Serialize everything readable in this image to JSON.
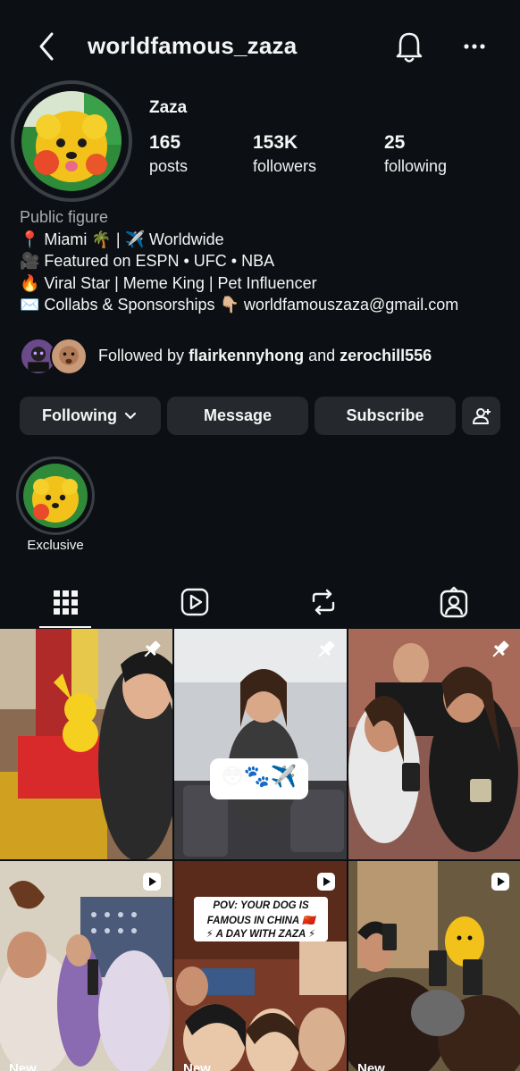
{
  "header": {
    "username": "worldfamous_zaza",
    "back_icon": "chevron-left-icon",
    "bell_icon": "bell-icon",
    "more_icon": "more-horizontal-icon"
  },
  "profile": {
    "display_name": "Zaza",
    "stats": [
      {
        "value": "165",
        "label": "posts"
      },
      {
        "value": "153K",
        "label": "followers"
      },
      {
        "value": "25",
        "label": "following"
      }
    ],
    "category": "Public figure",
    "bio": [
      "📍 Miami 🌴 | ✈️ Worldwide",
      "🎥 Featured on ESPN • UFC • NBA",
      "🔥 Viral Star | Meme King | Pet Influencer",
      "✉️ Collabs & Sponsorships 👇🏼 worldfamouszaza@gmail.com"
    ]
  },
  "followed_by": {
    "prefix": "Followed by ",
    "user1": "flairkennyhong",
    "joiner": " and ",
    "user2": "zerochill556"
  },
  "actions": {
    "following": "Following",
    "message": "Message",
    "subscribe": "Subscribe"
  },
  "highlights": [
    {
      "label": "Exclusive"
    }
  ],
  "tabs": [
    {
      "name": "grid",
      "icon": "grid-icon",
      "active": true
    },
    {
      "name": "reels",
      "icon": "reels-icon",
      "active": false
    },
    {
      "name": "reposts",
      "icon": "repost-icon",
      "active": false
    },
    {
      "name": "tagged",
      "icon": "tagged-icon",
      "active": false
    }
  ],
  "posts": [
    {
      "badge": "pin-icon",
      "overlay": ""
    },
    {
      "badge": "pin-icon",
      "overlay": "😳🐾✈️"
    },
    {
      "badge": "pin-icon",
      "overlay": ""
    },
    {
      "badge": "reel-icon",
      "overlay": "",
      "tag": "New"
    },
    {
      "badge": "reel-icon",
      "overlay_lines": [
        "POV: YOUR DOG IS",
        "FAMOUS IN CHINA 🇨🇳",
        "⚡ A DAY WITH ZAZA ⚡"
      ],
      "tag": "New"
    },
    {
      "badge": "reel-icon",
      "overlay": "",
      "tag": "New"
    }
  ],
  "colors": {
    "background": "#0c1014",
    "button": "#25292e",
    "text": "#f5f5f5",
    "muted": "#a8abb0"
  }
}
